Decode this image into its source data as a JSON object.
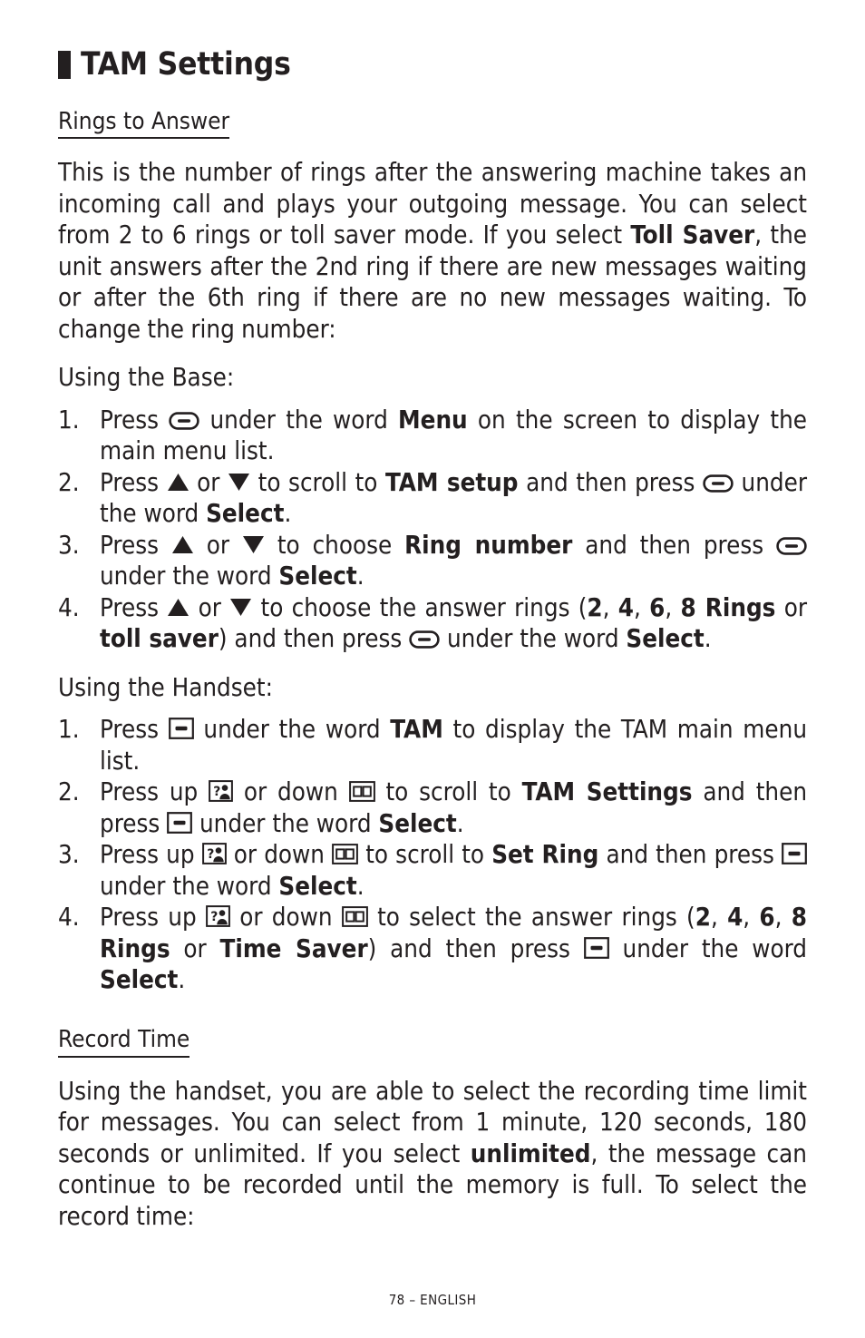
{
  "page": {
    "title": "TAM Settings",
    "footer": "78 – ENGLISH",
    "text_color": "#231f20",
    "background_color": "#ffffff"
  },
  "sections": {
    "rings_to_answer": {
      "heading": "Rings to Answer",
      "intro_paragraph": {
        "part1": "This is the number of rings after the answering machine takes an incoming call and plays your outgoing message.  You can select from 2 to 6 rings or toll saver mode.  If you select ",
        "bold1": "Toll Saver",
        "part2": ", the unit answers after the 2nd ring if there are new messages waiting or after the 6th ring if there are no new messages waiting.  To change the ring number:"
      },
      "using_base_label": "Using the Base:",
      "base_steps": [
        {
          "num": "1.",
          "t1": "Press ",
          "icon1": "softkey-base-icon",
          "t2": " under the word ",
          "b1": "Menu",
          "t3": " on the screen to display the main menu list."
        },
        {
          "num": "2.",
          "t1": "Press ",
          "icon1": "triangle-up-icon",
          "t2": " or ",
          "icon2": "triangle-down-icon",
          "t3": " to scroll to ",
          "b1": "TAM setup",
          "t4": " and then press ",
          "icon3": "softkey-base-icon",
          "t5": " under the word ",
          "b2": "Select",
          "t6": "."
        },
        {
          "num": "3.",
          "t1": "Press ",
          "icon1": "triangle-up-icon",
          "t2": " or ",
          "icon2": "triangle-down-icon",
          "t3": " to choose ",
          "b1": "Ring number",
          "t4": " and then press ",
          "icon3": "softkey-base-icon",
          "t5": " under the word ",
          "b2": "Select",
          "t6": "."
        },
        {
          "num": "4.",
          "t1": "Press ",
          "icon1": "triangle-up-icon",
          "t2": " or ",
          "icon2": "triangle-down-icon",
          "t3": " to choose the answer rings (",
          "b1": "2",
          "t4": ", ",
          "b2": "4",
          "t5": ", ",
          "b3": "6",
          "t6": ", ",
          "b4": "8 Rings",
          "t7": " or ",
          "b5": "toll saver",
          "t8": ") and then press ",
          "icon3": "softkey-base-icon",
          "t9": " under the word ",
          "b6": "Select",
          "t10": "."
        }
      ],
      "using_handset_label": "Using the Handset:",
      "handset_steps": [
        {
          "num": "1.",
          "t1": "Press ",
          "icon1": "softkey-handset-icon",
          "t2": " under the word ",
          "b1": "TAM",
          "t3": " to display the TAM main menu list."
        },
        {
          "num": "2.",
          "t1": "Press up ",
          "icon1": "caller-id-icon",
          "t2": " or down ",
          "icon2": "phonebook-icon",
          "t3": " to scroll to ",
          "b1": "TAM Settings",
          "t4": " and then press ",
          "icon3": "softkey-handset-icon",
          "t5": " under the word ",
          "b2": "Select",
          "t6": "."
        },
        {
          "num": "3.",
          "t1": "Press up ",
          "icon1": "caller-id-icon",
          "t2": " or down ",
          "icon2": "phonebook-icon",
          "t3": " to scroll to ",
          "b1": "Set Ring",
          "t4": " and then press ",
          "icon3": "softkey-handset-icon",
          "t5": " under the word ",
          "b2": "Select",
          "t6": "."
        },
        {
          "num": "4.",
          "t1": "Press up ",
          "icon1": "caller-id-icon",
          "t2": " or down ",
          "icon2": "phonebook-icon",
          "t3": " to select the answer rings (",
          "b1": "2",
          "t4": ", ",
          "b2": "4",
          "t5": ", ",
          "b3": "6",
          "t6": ", ",
          "b4": "8 Rings",
          "t7": " or ",
          "b5": "Time Saver",
          "t8": ") and then press ",
          "icon3": "softkey-handset-icon",
          "t9": " under the word ",
          "b6": "Select",
          "t10": "."
        }
      ]
    },
    "record_time": {
      "heading": "Record Time",
      "paragraph": {
        "part1": "Using the handset, you are able to select the recording time limit for messages.  You can select from 1 minute, 120 seconds, 180 seconds or unlimited.  If you select ",
        "bold1": "unlimited",
        "part2": ", the message can continue to be recorded until the memory is full.  To select the record time:"
      }
    }
  },
  "icons": {
    "softkey-base-icon": "rounded pill outline with horizontal dash inside",
    "softkey-handset-icon": "square outline with thick horizontal bar inside",
    "triangle-up-icon": "solid filled triangle pointing up",
    "triangle-down-icon": "solid filled triangle pointing down",
    "caller-id-icon": "boxed question mark beside person silhouette",
    "phonebook-icon": "boxed open book glyph"
  }
}
